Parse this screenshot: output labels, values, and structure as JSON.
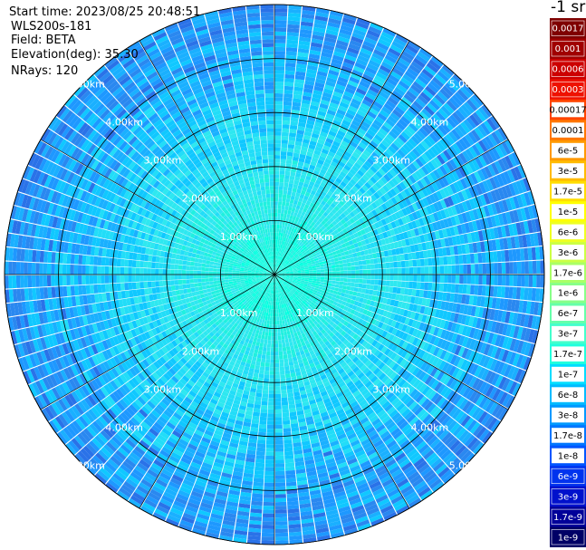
{
  "header": {
    "start_time": "Start time: 2023/08/25 20:48:51",
    "instrument": "WLS200s-181",
    "field": "Field: BETA",
    "elevation": "Elevation(deg): 35.30",
    "nrays": "NRays: 120"
  },
  "colorbar": {
    "unit_label": "-1 sr",
    "ticks": [
      "0.0017",
      "0.001",
      "0.0006",
      "0.0003",
      "0.00017",
      "0.0001",
      "6e-5",
      "3e-5",
      "1.7e-5",
      "1e-5",
      "6e-6",
      "3e-6",
      "1.7e-6",
      "1e-6",
      "6e-7",
      "3e-7",
      "1.7e-7",
      "1e-7",
      "6e-8",
      "3e-8",
      "1.7e-8",
      "1e-8",
      "6e-9",
      "3e-9",
      "1.7e-9",
      "1e-9"
    ],
    "colors": [
      "#7f0000",
      "#a00000",
      "#cc0000",
      "#ee1100",
      "#ff4400",
      "#ff7700",
      "#ff9900",
      "#ffbb00",
      "#ffdd00",
      "#ffff00",
      "#eeff22",
      "#ccff44",
      "#aaff66",
      "#88ff88",
      "#66ffaa",
      "#44ffcc",
      "#22ffdd",
      "#00ddff",
      "#00bbff",
      "#0099ff",
      "#0077ff",
      "#0055ff",
      "#0033ee",
      "#0011cc",
      "#000099",
      "#000066"
    ]
  },
  "chart_data": {
    "type": "heatmap",
    "projection": "polar (PPI scan)",
    "rays": 120,
    "elevation_deg": 35.3,
    "field": "BETA",
    "range_rings_km": [
      1,
      2,
      3,
      4,
      5
    ],
    "range_labels": [
      "1.00km",
      "2.00km",
      "3.00km",
      "4.00km",
      "5.00km"
    ],
    "max_range_km": 5.0,
    "color_scale": "log",
    "value_range": [
      1e-09,
      0.0017
    ],
    "typical_values": {
      "near_center": "1.7e-7",
      "mid_range": "1e-7",
      "outer_range": "3e-8"
    }
  }
}
